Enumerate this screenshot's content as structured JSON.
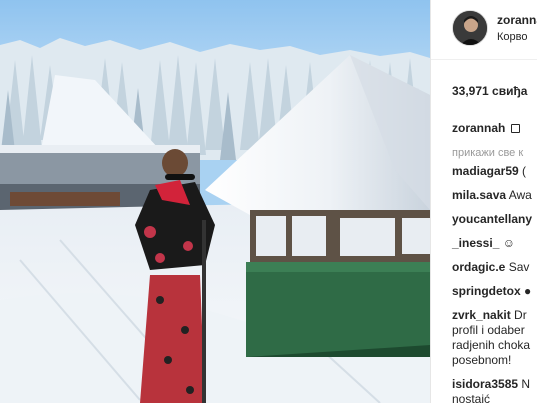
{
  "post": {
    "username": "zorannah",
    "location": "Корво",
    "likes": "33,971 свиђа",
    "caption_user": "zorannah",
    "caption_icon": "white-heart",
    "show_all": "прикажи све к"
  },
  "comments": [
    {
      "user": "madiagar59",
      "text": " (",
      "kind": "single"
    },
    {
      "user": "mila.sava",
      "text": " Awa",
      "kind": "single"
    },
    {
      "user": "youcantellany",
      "text": "",
      "kind": "single"
    },
    {
      "user": "_inessi_",
      "text": " ☺",
      "kind": "single"
    },
    {
      "user": "ordagic.e",
      "text": " Sav",
      "kind": "single"
    },
    {
      "user": "springdetox",
      "text": " ●",
      "kind": "single"
    },
    {
      "user": "zvrk_nakit",
      "text": " Dr",
      "kind": "multi",
      "lines": [
        "profil i odaber",
        "radjenih choka",
        "posebnom!"
      ]
    },
    {
      "user": "isidora3585",
      "text": " N",
      "kind": "single"
    }
  ],
  "last_line": "nostajć"
}
